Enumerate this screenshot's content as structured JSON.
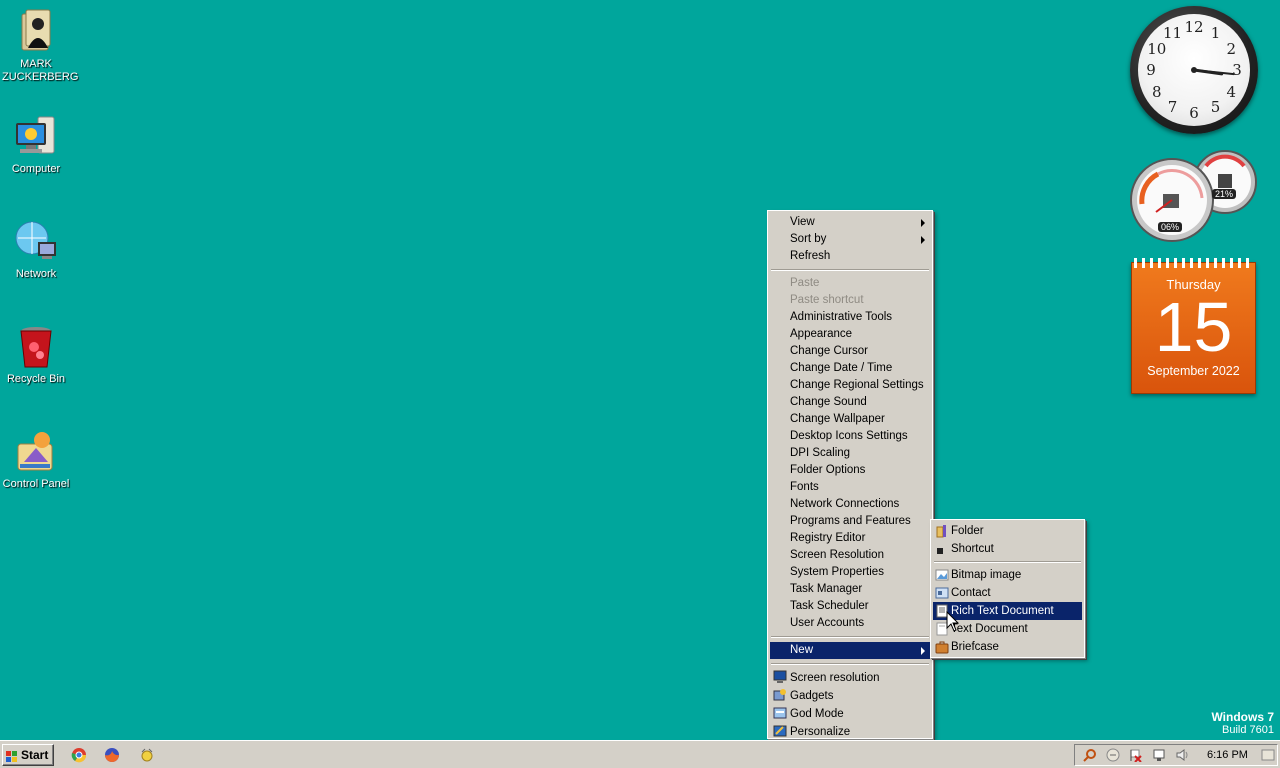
{
  "desktop_icons": [
    {
      "label": "MARK ZUCKERBERG",
      "icon": "user-folder-icon"
    },
    {
      "label": "Computer",
      "icon": "computer-icon"
    },
    {
      "label": "Network",
      "icon": "network-icon"
    },
    {
      "label": "Recycle Bin",
      "icon": "recycle-bin-icon"
    },
    {
      "label": "Control Panel",
      "icon": "control-panel-icon"
    }
  ],
  "context_menu": {
    "top": [
      {
        "label": "View",
        "submenu": true
      },
      {
        "label": "Sort by",
        "submenu": true
      },
      {
        "label": "Refresh"
      }
    ],
    "disabled": [
      {
        "label": "Paste"
      },
      {
        "label": "Paste shortcut"
      }
    ],
    "tools": [
      {
        "label": "Administrative Tools"
      },
      {
        "label": "Appearance"
      },
      {
        "label": "Change Cursor"
      },
      {
        "label": "Change Date / Time"
      },
      {
        "label": "Change Regional Settings"
      },
      {
        "label": "Change Sound"
      },
      {
        "label": "Change Wallpaper"
      },
      {
        "label": "Desktop Icons Settings"
      },
      {
        "label": "DPI Scaling"
      },
      {
        "label": "Folder Options"
      },
      {
        "label": "Fonts"
      },
      {
        "label": "Network Connections"
      },
      {
        "label": "Programs and Features"
      },
      {
        "label": "Registry Editor"
      },
      {
        "label": "Screen Resolution"
      },
      {
        "label": "System Properties"
      },
      {
        "label": "Task Manager"
      },
      {
        "label": "Task Scheduler"
      },
      {
        "label": "User Accounts"
      }
    ],
    "new_label": "New",
    "bottom": [
      {
        "label": "Screen resolution",
        "icon": "monitor-icon"
      },
      {
        "label": "Gadgets",
        "icon": "gadgets-icon"
      },
      {
        "label": "God Mode",
        "icon": "control-panel-icon"
      },
      {
        "label": "Personalize",
        "icon": "personalize-icon"
      }
    ]
  },
  "new_submenu": {
    "top": [
      {
        "label": "Folder",
        "icon": "folder-icon"
      },
      {
        "label": "Shortcut",
        "icon": "shortcut-icon"
      }
    ],
    "items": [
      {
        "label": "Bitmap image",
        "icon": "bitmap-icon"
      },
      {
        "label": "Contact",
        "icon": "contact-icon"
      },
      {
        "label": "Rich Text Document",
        "icon": "rtf-document-icon",
        "selected": true
      },
      {
        "label": "Text Document",
        "icon": "text-document-icon"
      },
      {
        "label": "Briefcase",
        "icon": "briefcase-icon"
      }
    ]
  },
  "clock": {
    "numbers": [
      "12",
      "1",
      "2",
      "3",
      "4",
      "5",
      "6",
      "7",
      "8",
      "9",
      "10",
      "11"
    ],
    "hour": 3,
    "minute": 16
  },
  "cpu_meter": {
    "cpu": "06%",
    "memory": "21%"
  },
  "calendar": {
    "weekday": "Thursday",
    "day": "15",
    "month_year": "September 2022"
  },
  "branding": {
    "os": "Windows 7",
    "build": "Build 7601"
  },
  "taskbar": {
    "start_label": "Start",
    "quick_launch": [
      "chrome-icon",
      "firefox-icon",
      "folder-gadget-icon"
    ],
    "tray_icons": [
      "search-icon",
      "volume-mixer-icon",
      "flag-icon",
      "network-tray-icon",
      "speaker-icon"
    ],
    "time": "6:16 PM"
  },
  "colors": {
    "desktop": "#00a69c",
    "menu_bg": "#d4d0c8",
    "selection": "#0a246a",
    "calendar": "#e8651a"
  }
}
